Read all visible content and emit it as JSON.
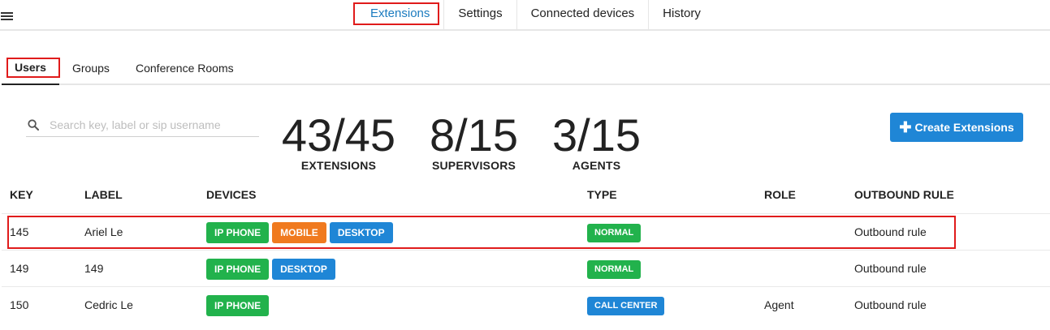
{
  "nav": {
    "tabs": [
      {
        "label": "Extensions",
        "active": true
      },
      {
        "label": "Settings"
      },
      {
        "label": "Connected devices"
      },
      {
        "label": "History"
      }
    ]
  },
  "subtabs": {
    "users": "Users",
    "groups": "Groups",
    "rooms": "Conference Rooms"
  },
  "search": {
    "placeholder": "Search key, label or sip username",
    "value": ""
  },
  "stats": {
    "extensions": {
      "value": "43/45",
      "label": "EXTENSIONS"
    },
    "supervisors": {
      "value": "8/15",
      "label": "SUPERVISORS"
    },
    "agents": {
      "value": "3/15",
      "label": "AGENTS"
    }
  },
  "create_button": {
    "label": "Create Extensions",
    "icon": "plus-icon"
  },
  "table": {
    "headers": {
      "key": "KEY",
      "label": "LABEL",
      "devices": "DEVICES",
      "type": "TYPE",
      "role": "ROLE",
      "rule": "OUTBOUND RULE"
    },
    "rows": [
      {
        "key": "145",
        "label": "Ariel Le",
        "devices": [
          "IP PHONE",
          "MOBILE",
          "DESKTOP"
        ],
        "type": "NORMAL",
        "role": "",
        "rule": "Outbound rule"
      },
      {
        "key": "149",
        "label": "149",
        "devices": [
          "IP PHONE",
          "DESKTOP"
        ],
        "type": "NORMAL",
        "role": "",
        "rule": "Outbound rule"
      },
      {
        "key": "150",
        "label": "Cedric Le",
        "devices": [
          "IP PHONE"
        ],
        "type": "CALL CENTER",
        "role": "Agent",
        "rule": "Outbound rule"
      }
    ]
  },
  "colors": {
    "accent": "#1f86d6",
    "green": "#22b24c",
    "orange": "#f07a1f",
    "highlight": "#e01b1b"
  }
}
